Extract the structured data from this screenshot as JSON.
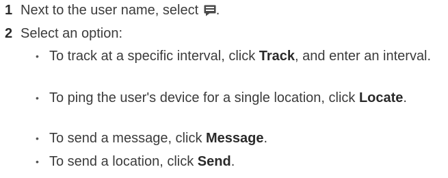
{
  "steps": [
    {
      "number": "1",
      "text_before": "Next to the user name, select ",
      "icon": "message-icon",
      "text_after": "."
    },
    {
      "number": "2",
      "text": "Select an option:"
    }
  ],
  "bullet_marker": "•",
  "bullets": [
    {
      "pre": "To track at a specific interval, click ",
      "bold": "Track",
      "post": ", and enter an interval."
    },
    {
      "pre": "To ping the user's device for a single location, click ",
      "bold": "Locate",
      "post": "."
    },
    {
      "pre": "To send a message, click ",
      "bold": "Message",
      "post": "."
    },
    {
      "pre": "To send a location, click ",
      "bold": "Send",
      "post": "."
    }
  ],
  "colors": {
    "text": "#3b3b3b",
    "icon": "#4a4a4a"
  }
}
